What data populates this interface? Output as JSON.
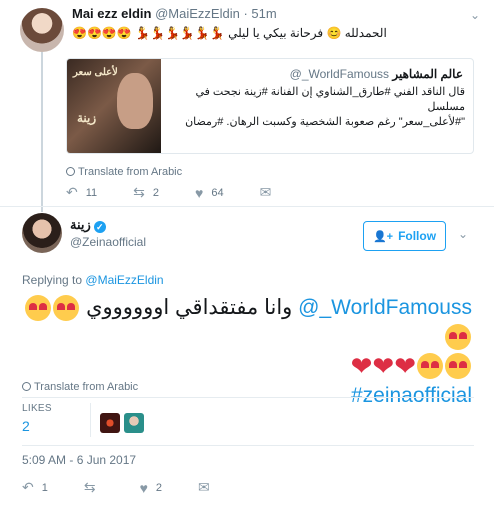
{
  "parent_tweet": {
    "name": "Mai ezz eldin",
    "handle": "@MaiEzzEldin",
    "time": "51m",
    "text": "الحمدلله 😊 فرحانة بيكي يا ليلي 💃💃💃💃💃💃 😍😍😍😍",
    "quoted": {
      "name": "عالم المشاهير",
      "handle": "@_WorldFamouss",
      "image_title": "لأعلى سعر",
      "image_subtitle": "زينة",
      "text_line1": "قال الناقد الفني #طارق_الشناوي إن الفنانة #زينة نجحت في مسلسل",
      "text_line2": "\"#لأعلى_سعر\" رغم صعوبة الشخصية وكسبت الرهان. #رمضان"
    },
    "translate_label": "Translate from Arabic",
    "stats": {
      "replies": "11",
      "retweets": "2",
      "likes": "64"
    }
  },
  "main_tweet": {
    "name": "زينة",
    "handle": "@Zeinaofficial",
    "follow_label": "Follow",
    "replying_prefix": "Replying to",
    "replying_handle": "@MaiEzzEldin",
    "text_mention": "@_WorldFamouss",
    "text_arabic": "وانا مفتقداقي اووووووي",
    "hashtag": "#zeinaofficial",
    "translate_label": "Translate from Arabic",
    "likes_label": "LIKES",
    "likes_count": "2",
    "timestamp": "5:09 AM - 6 Jun 2017",
    "stats": {
      "replies": "1",
      "retweets": "",
      "likes": "2"
    }
  },
  "colors": {
    "link": "#1b95e0",
    "muted": "#657786",
    "heart": "#dd2e44",
    "follow_border": "#1da1f2"
  },
  "icons": [
    "reply-icon",
    "retweet-icon",
    "like-icon",
    "dm-icon",
    "globe-icon",
    "verified-icon",
    "chevron-down-icon",
    "user-plus-icon"
  ]
}
